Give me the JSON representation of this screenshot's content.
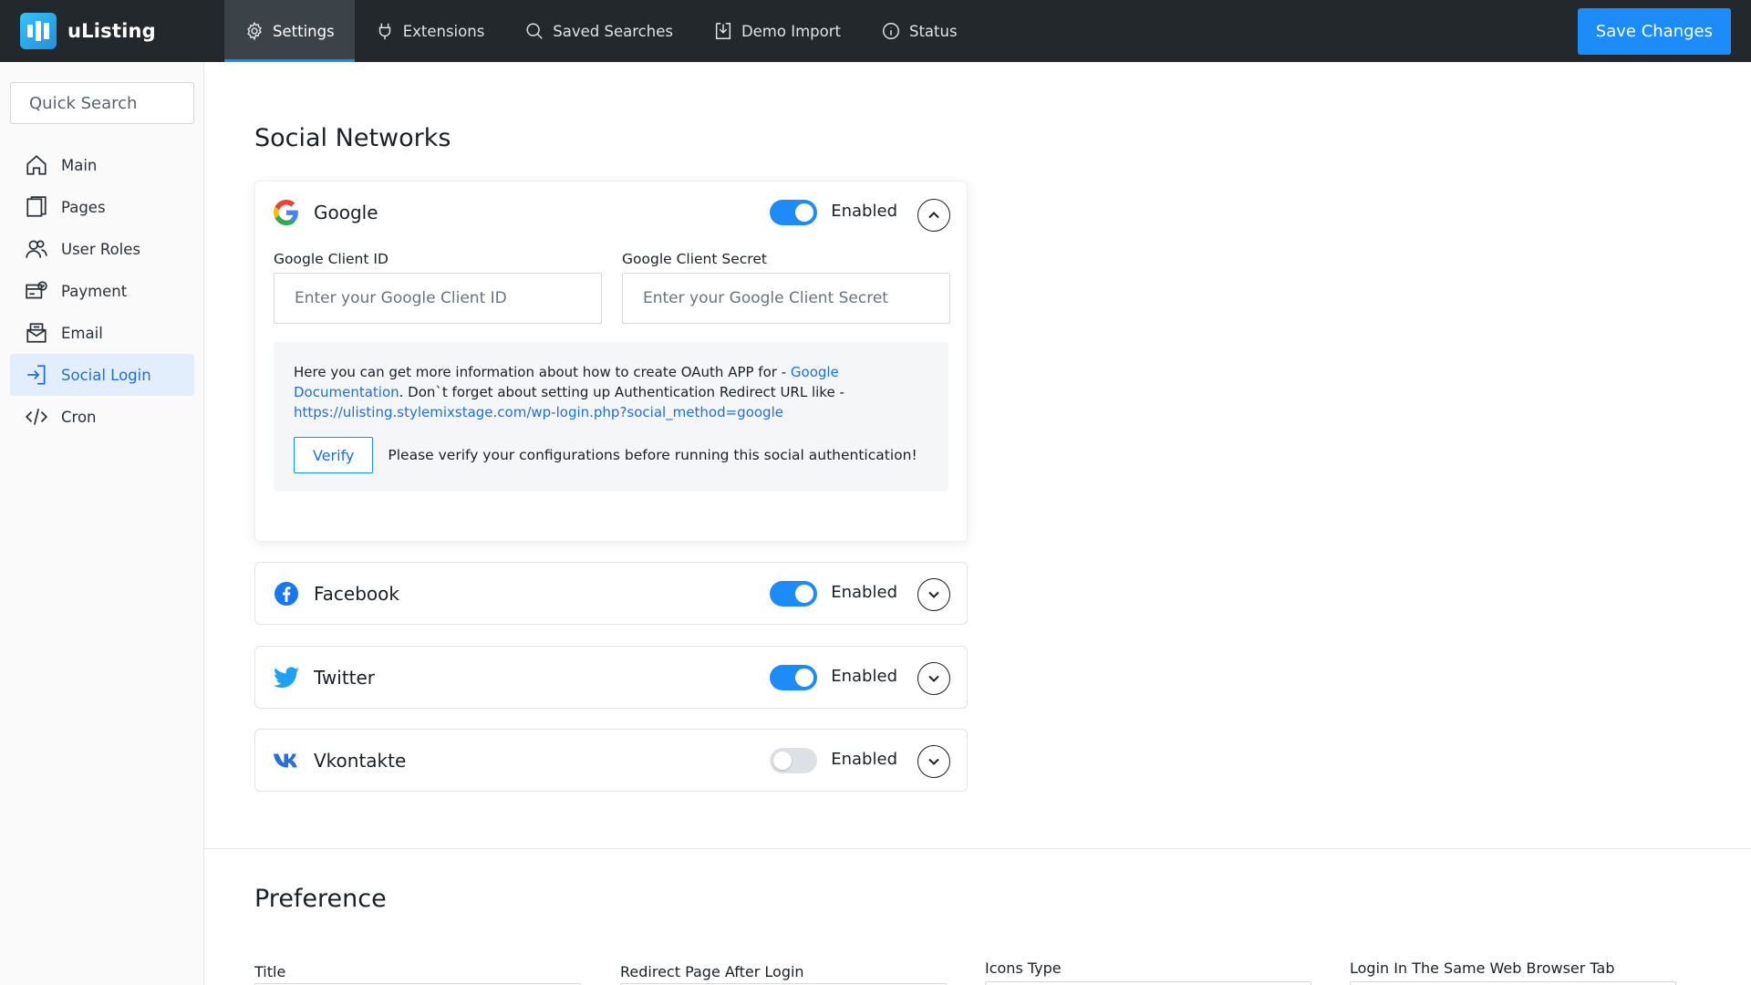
{
  "app": {
    "name": "uListing"
  },
  "nav": {
    "items": [
      {
        "label": "Settings",
        "icon": "gear-icon",
        "active": true
      },
      {
        "label": "Extensions",
        "icon": "plug-icon",
        "active": false
      },
      {
        "label": "Saved Searches",
        "icon": "search-icon",
        "active": false
      },
      {
        "label": "Demo Import",
        "icon": "download-icon",
        "active": false
      },
      {
        "label": "Status",
        "icon": "info-icon",
        "active": false
      }
    ],
    "save_label": "Save Changes"
  },
  "sidebar": {
    "search_placeholder": "Quick Search",
    "items": [
      {
        "label": "Main",
        "icon": "home-icon",
        "active": false
      },
      {
        "label": "Pages",
        "icon": "pages-icon",
        "active": false
      },
      {
        "label": "User Roles",
        "icon": "users-icon",
        "active": false
      },
      {
        "label": "Payment",
        "icon": "payment-icon",
        "active": false
      },
      {
        "label": "Email",
        "icon": "email-icon",
        "active": false
      },
      {
        "label": "Social Login",
        "icon": "login-icon",
        "active": true
      },
      {
        "label": "Cron",
        "icon": "code-icon",
        "active": false
      }
    ]
  },
  "social": {
    "title": "Social Networks",
    "google": {
      "name": "Google",
      "toggle_label": "Enabled",
      "enabled": true,
      "client_id_label": "Google Client ID",
      "client_id_placeholder": "Enter your Google Client ID",
      "client_secret_label": "Google Client Secret",
      "client_secret_placeholder": "Enter your Google Client Secret",
      "info_text_1": "Here you can get more information about how to create OAuth APP for - ",
      "info_link": "Google Documentation",
      "info_text_2": ". Don`t forget about setting up Authentication Redirect URL like -",
      "redirect_url": "https://ulisting.stylemixstage.com/wp-login.php?social_method=google",
      "verify_label": "Verify",
      "verify_note": "Please verify your configurations before running this social authentication!"
    },
    "facebook": {
      "name": "Facebook",
      "toggle_label": "Enabled",
      "enabled": true
    },
    "twitter": {
      "name": "Twitter",
      "toggle_label": "Enabled",
      "enabled": true
    },
    "vkontakte": {
      "name": "Vkontakte",
      "toggle_label": "Enabled",
      "enabled": false
    }
  },
  "preference": {
    "title": "Preference",
    "fields": [
      "Title",
      "Redirect Page After Login",
      "Icons Type",
      "Login In The Same Web Browser Tab"
    ]
  },
  "colors": {
    "accent": "#1e8cf8",
    "topbar": "#23282d",
    "sidebar_active": "#e3eefc"
  }
}
